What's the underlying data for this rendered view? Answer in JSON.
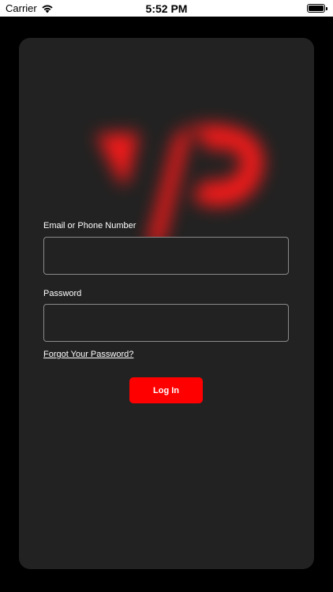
{
  "status_bar": {
    "carrier": "Carrier",
    "time": "5:52 PM"
  },
  "login": {
    "email_label": "Email or Phone Number",
    "email_value": "",
    "password_label": "Password",
    "password_value": "",
    "forgot_password": "Forgot Your Password?",
    "login_button": "Log In"
  },
  "colors": {
    "background": "#000000",
    "card": "#222222",
    "accent": "#ff0000",
    "logo": "#ff1a1a"
  },
  "icons": [
    "wifi-icon",
    "battery-icon",
    "brand-logo"
  ]
}
